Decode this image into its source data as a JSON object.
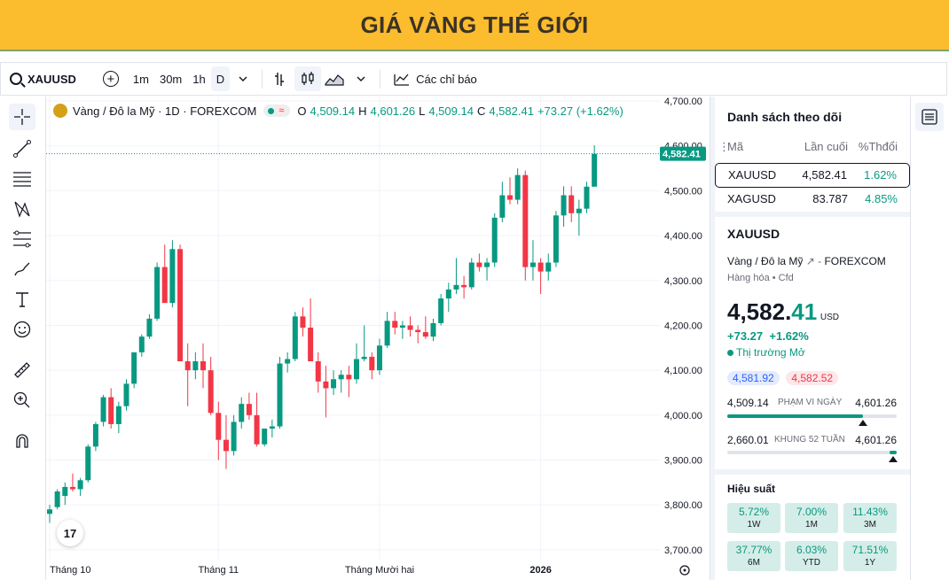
{
  "banner": {
    "title": "GIÁ VÀNG THẾ GIỚI"
  },
  "toolbar": {
    "symbol": "XAUUSD",
    "intervals": [
      "1m",
      "30m",
      "1h",
      "D"
    ],
    "active_interval": "D",
    "indicators_label": "Các chỉ báo"
  },
  "legend": {
    "name": "Vàng / Đô la Mỹ · 1D · FOREXCOM",
    "open_label": "O",
    "open": "4,509.14",
    "high_label": "H",
    "high": "4,601.26",
    "low_label": "L",
    "low": "4,509.14",
    "close_label": "C",
    "close": "4,582.41",
    "change": "+73.27 (+1.62%)",
    "tag": "≈"
  },
  "logo_text": "17",
  "chart_data": {
    "type": "candlestick",
    "symbol": "XAUUSD",
    "ylim": [
      3680,
      4710
    ],
    "y_ticks": [
      3700,
      3800,
      3900,
      4000,
      4100,
      4200,
      4300,
      4400,
      4500,
      4600,
      4700
    ],
    "y_tick_labels": [
      "3,700.00",
      "3,800.00",
      "3,900.00",
      "4,000.00",
      "4,100.00",
      "4,200.00",
      "4,300.00",
      "4,400.00",
      "4,500.00",
      "4,600.00",
      "4,700.00"
    ],
    "x_labels": [
      {
        "label": "Tháng 10",
        "index": 0
      },
      {
        "label": "Tháng 11",
        "index": 22
      },
      {
        "label": "Tháng Mười hai",
        "index": 43
      },
      {
        "label": "2026",
        "index": 64
      }
    ],
    "x_label_bold": "2026",
    "last_price": 4582.41,
    "last_price_label": "4,582.41",
    "up_color": "#089981",
    "down_color": "#f23645",
    "ohlc": [
      [
        3780,
        3800,
        3760,
        3790
      ],
      [
        3795,
        3835,
        3790,
        3830
      ],
      [
        3820,
        3850,
        3800,
        3840
      ],
      [
        3840,
        3870,
        3830,
        3835
      ],
      [
        3835,
        3860,
        3820,
        3855
      ],
      [
        3855,
        3935,
        3850,
        3930
      ],
      [
        3930,
        3985,
        3920,
        3980
      ],
      [
        3985,
        4045,
        3975,
        4040
      ],
      [
        4040,
        4060,
        3970,
        3980
      ],
      [
        3980,
        4030,
        3960,
        4020
      ],
      [
        4020,
        4080,
        4010,
        4070
      ],
      [
        4070,
        4140,
        4060,
        4140
      ],
      [
        4140,
        4180,
        4130,
        4175
      ],
      [
        4175,
        4225,
        4170,
        4215
      ],
      [
        4215,
        4340,
        4210,
        4330
      ],
      [
        4330,
        4380,
        4280,
        4250
      ],
      [
        4250,
        4390,
        4240,
        4370
      ],
      [
        4370,
        4380,
        4260,
        4120
      ],
      [
        4120,
        4160,
        4020,
        4100
      ],
      [
        4100,
        4140,
        4080,
        4120
      ],
      [
        4120,
        4160,
        4060,
        4100
      ],
      [
        4100,
        4130,
        4000,
        4005
      ],
      [
        4005,
        4030,
        3900,
        3945
      ],
      [
        3945,
        4000,
        3880,
        3920
      ],
      [
        3920,
        4000,
        3910,
        3985
      ],
      [
        3985,
        4040,
        3970,
        4025
      ],
      [
        4025,
        4050,
        3990,
        4000
      ],
      [
        4000,
        4050,
        3930,
        3935
      ],
      [
        3935,
        3970,
        3930,
        3970
      ],
      [
        3970,
        3990,
        3950,
        3975
      ],
      [
        3975,
        4130,
        3970,
        4115
      ],
      [
        4115,
        4140,
        4095,
        4125
      ],
      [
        4125,
        4230,
        4120,
        4220
      ],
      [
        4220,
        4240,
        4175,
        4195
      ],
      [
        4195,
        4260,
        4120,
        4120
      ],
      [
        4120,
        4140,
        4050,
        4075
      ],
      [
        4075,
        4110,
        3995,
        4060
      ],
      [
        4060,
        4100,
        4045,
        4080
      ],
      [
        4080,
        4100,
        4050,
        4090
      ],
      [
        4090,
        4110,
        4040,
        4080
      ],
      [
        4080,
        4160,
        4070,
        4125
      ],
      [
        4125,
        4200,
        4120,
        4130
      ],
      [
        4130,
        4140,
        4080,
        4100
      ],
      [
        4100,
        4170,
        4090,
        4155
      ],
      [
        4155,
        4230,
        4150,
        4210
      ],
      [
        4210,
        4230,
        4180,
        4195
      ],
      [
        4195,
        4210,
        4170,
        4200
      ],
      [
        4200,
        4220,
        4175,
        4190
      ],
      [
        4190,
        4200,
        4160,
        4185
      ],
      [
        4185,
        4220,
        4170,
        4175
      ],
      [
        4175,
        4215,
        4165,
        4205
      ],
      [
        4205,
        4270,
        4200,
        4260
      ],
      [
        4260,
        4295,
        4230,
        4280
      ],
      [
        4280,
        4350,
        4270,
        4290
      ],
      [
        4290,
        4310,
        4260,
        4285
      ],
      [
        4285,
        4350,
        4280,
        4340
      ],
      [
        4340,
        4360,
        4320,
        4330
      ],
      [
        4330,
        4350,
        4300,
        4340
      ],
      [
        4340,
        4450,
        4330,
        4440
      ],
      [
        4440,
        4520,
        4430,
        4490
      ],
      [
        4490,
        4530,
        4470,
        4480
      ],
      [
        4480,
        4550,
        4470,
        4535
      ],
      [
        4535,
        4545,
        4300,
        4330
      ],
      [
        4330,
        4390,
        4300,
        4340
      ],
      [
        4340,
        4350,
        4270,
        4320
      ],
      [
        4320,
        4360,
        4300,
        4340
      ],
      [
        4340,
        4455,
        4330,
        4445
      ],
      [
        4445,
        4510,
        4420,
        4490
      ],
      [
        4490,
        4510,
        4430,
        4450
      ],
      [
        4450,
        4480,
        4400,
        4460
      ],
      [
        4460,
        4520,
        4450,
        4509.14
      ],
      [
        4509.14,
        4601.26,
        4509.14,
        4582.41
      ]
    ]
  },
  "watchlist": {
    "title": "Danh sách theo dõi",
    "headers": [
      "Mã",
      "Lần cuối",
      "%Thđổi"
    ],
    "rows": [
      {
        "symbol": "XAUUSD",
        "last": "4,582.41",
        "change": "1.62%"
      },
      {
        "symbol": "XAGUSD",
        "last": "83.787",
        "change": "4.85%"
      }
    ]
  },
  "details": {
    "symbol": "XAUUSD",
    "name": "Vàng / Đô la Mỹ",
    "exchange": "FOREXCOM",
    "category": "Hàng hóa • Cfd",
    "price_int": "4,582.",
    "price_dec": "41",
    "currency": "USD",
    "change_abs": "+73.27",
    "change_pct": "+1.62%",
    "market_status": "Thị trường Mở",
    "bid": "4,581.92",
    "ask": "4,582.52",
    "day_low": "4,509.14",
    "day_label": "PHẠM VI NGÀY",
    "day_high": "4,601.26",
    "day_fill": 0.8,
    "wk_low": "2,660.01",
    "wk_label": "KHUNG 52 TUẦN",
    "wk_high": "4,601.26",
    "wk_fill": 0.96,
    "perf_title": "Hiệu suất",
    "perf": [
      {
        "value": "5.72%",
        "label": "1W"
      },
      {
        "value": "7.00%",
        "label": "1M"
      },
      {
        "value": "11.43%",
        "label": "3M"
      },
      {
        "value": "37.77%",
        "label": "6M"
      },
      {
        "value": "6.03%",
        "label": "YTD"
      },
      {
        "value": "71.51%",
        "label": "1Y"
      }
    ]
  }
}
